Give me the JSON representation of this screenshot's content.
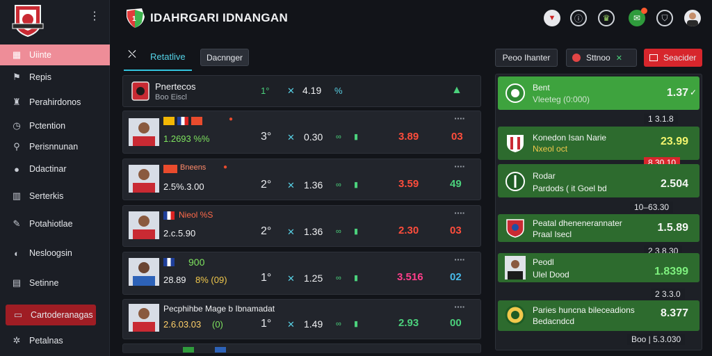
{
  "sidebar": {
    "items": [
      {
        "label": "Uiinte",
        "icon": "grid-icon"
      },
      {
        "label": "Repis",
        "icon": "flag-icon"
      },
      {
        "label": "Perahirdonos",
        "icon": "bell-icon"
      },
      {
        "label": "Pctention",
        "icon": "clock-icon"
      },
      {
        "label": "Perisnnunan",
        "icon": "search-icon"
      },
      {
        "label": "Ddactinar",
        "icon": "user-icon"
      },
      {
        "label": "Serterkis",
        "icon": "chart-icon"
      },
      {
        "label": "Potahiotlae",
        "icon": "pencil-icon"
      },
      {
        "label": "Nesloogsin",
        "icon": "chat-icon"
      },
      {
        "label": "Setinne",
        "icon": "bars-icon"
      },
      {
        "label": "Cartoderanagas",
        "icon": "card-icon"
      },
      {
        "label": "Petalnas",
        "icon": "gear-icon"
      }
    ]
  },
  "header": {
    "title": "IDAHRGARI IDNANGAN",
    "brand_badge": "1"
  },
  "tabs": {
    "live_label": "Retatlive",
    "managers_label": "Dacnnger"
  },
  "match_head": {
    "name": "Pnertecos",
    "sub": "Boo Eiscl",
    "odd1": "1°",
    "score": "4.19",
    "odd2": "%"
  },
  "matches": [
    {
      "tag": "1.2693 %%",
      "score": "3°",
      "value": "0.30",
      "odd_a": "3.89",
      "odd_b": "03",
      "odd_a_color": "#ff4d3c",
      "odd_b_color": "#ff4d3c"
    },
    {
      "tag": "Bneens",
      "detail": "2.5%.3.00",
      "score": "2°",
      "value": "1.36",
      "odd_a": "3.59",
      "odd_b": "49",
      "odd_a_color": "#ff4d3c",
      "odd_b_color": "#4bd17c"
    },
    {
      "tag": "Nieol %S",
      "detail": "2.c.5.90",
      "score": "2°",
      "value": "1.36",
      "odd_a": "2.30",
      "odd_b": "03",
      "odd_a_color": "#ff4d3c",
      "odd_b_color": "#ff4d3c"
    },
    {
      "tag": "900",
      "detail": "28.89",
      "detail2": "8% (09)",
      "score": "1°",
      "value": "1.25",
      "odd_a": "3.516",
      "odd_b": "02",
      "odd_a_color": "#ff3e8a",
      "odd_b_color": "#47b9e8"
    },
    {
      "tag": "Pecphihbe Mage b Ibnamadat",
      "detail": "2.6.03.03",
      "detail2": "(0)",
      "score": "1°",
      "value": "1.49",
      "odd_a": "2.93",
      "odd_b": "00",
      "odd_a_color": "#4bd17c",
      "odd_b_color": "#4bd17c"
    }
  ],
  "right_panel": {
    "btn_primary": "Peoo Ihanter",
    "btn_secondary": "Sttnoo",
    "btn_danger": "Seacider",
    "cards": [
      {
        "title": "Bent",
        "sub": "Vleeteg (0:000)",
        "value": "1.37"
      },
      {
        "title": "Konedon Isan Narie",
        "sub": "Nxeol oct",
        "value": "23.99"
      },
      {
        "title": "Rodar",
        "sub": "Pardods ( it Goel bd",
        "value": "2.504"
      },
      {
        "title": "Peatal dhenenerannater",
        "sub": "Praal Isecl",
        "value": "1.5.89"
      },
      {
        "title": "Peodl",
        "sub": "Ulel Dood",
        "value": "1.8399"
      },
      {
        "title": "Paries huncna bileceadions",
        "sub": "Bedacndcd",
        "value": "8.377"
      }
    ],
    "chips": [
      "1 3.1.8",
      "8.30.10",
      "10–63.30",
      "2 3.8.30",
      "2 3.3.0",
      "Boo | 5.3.030"
    ]
  }
}
